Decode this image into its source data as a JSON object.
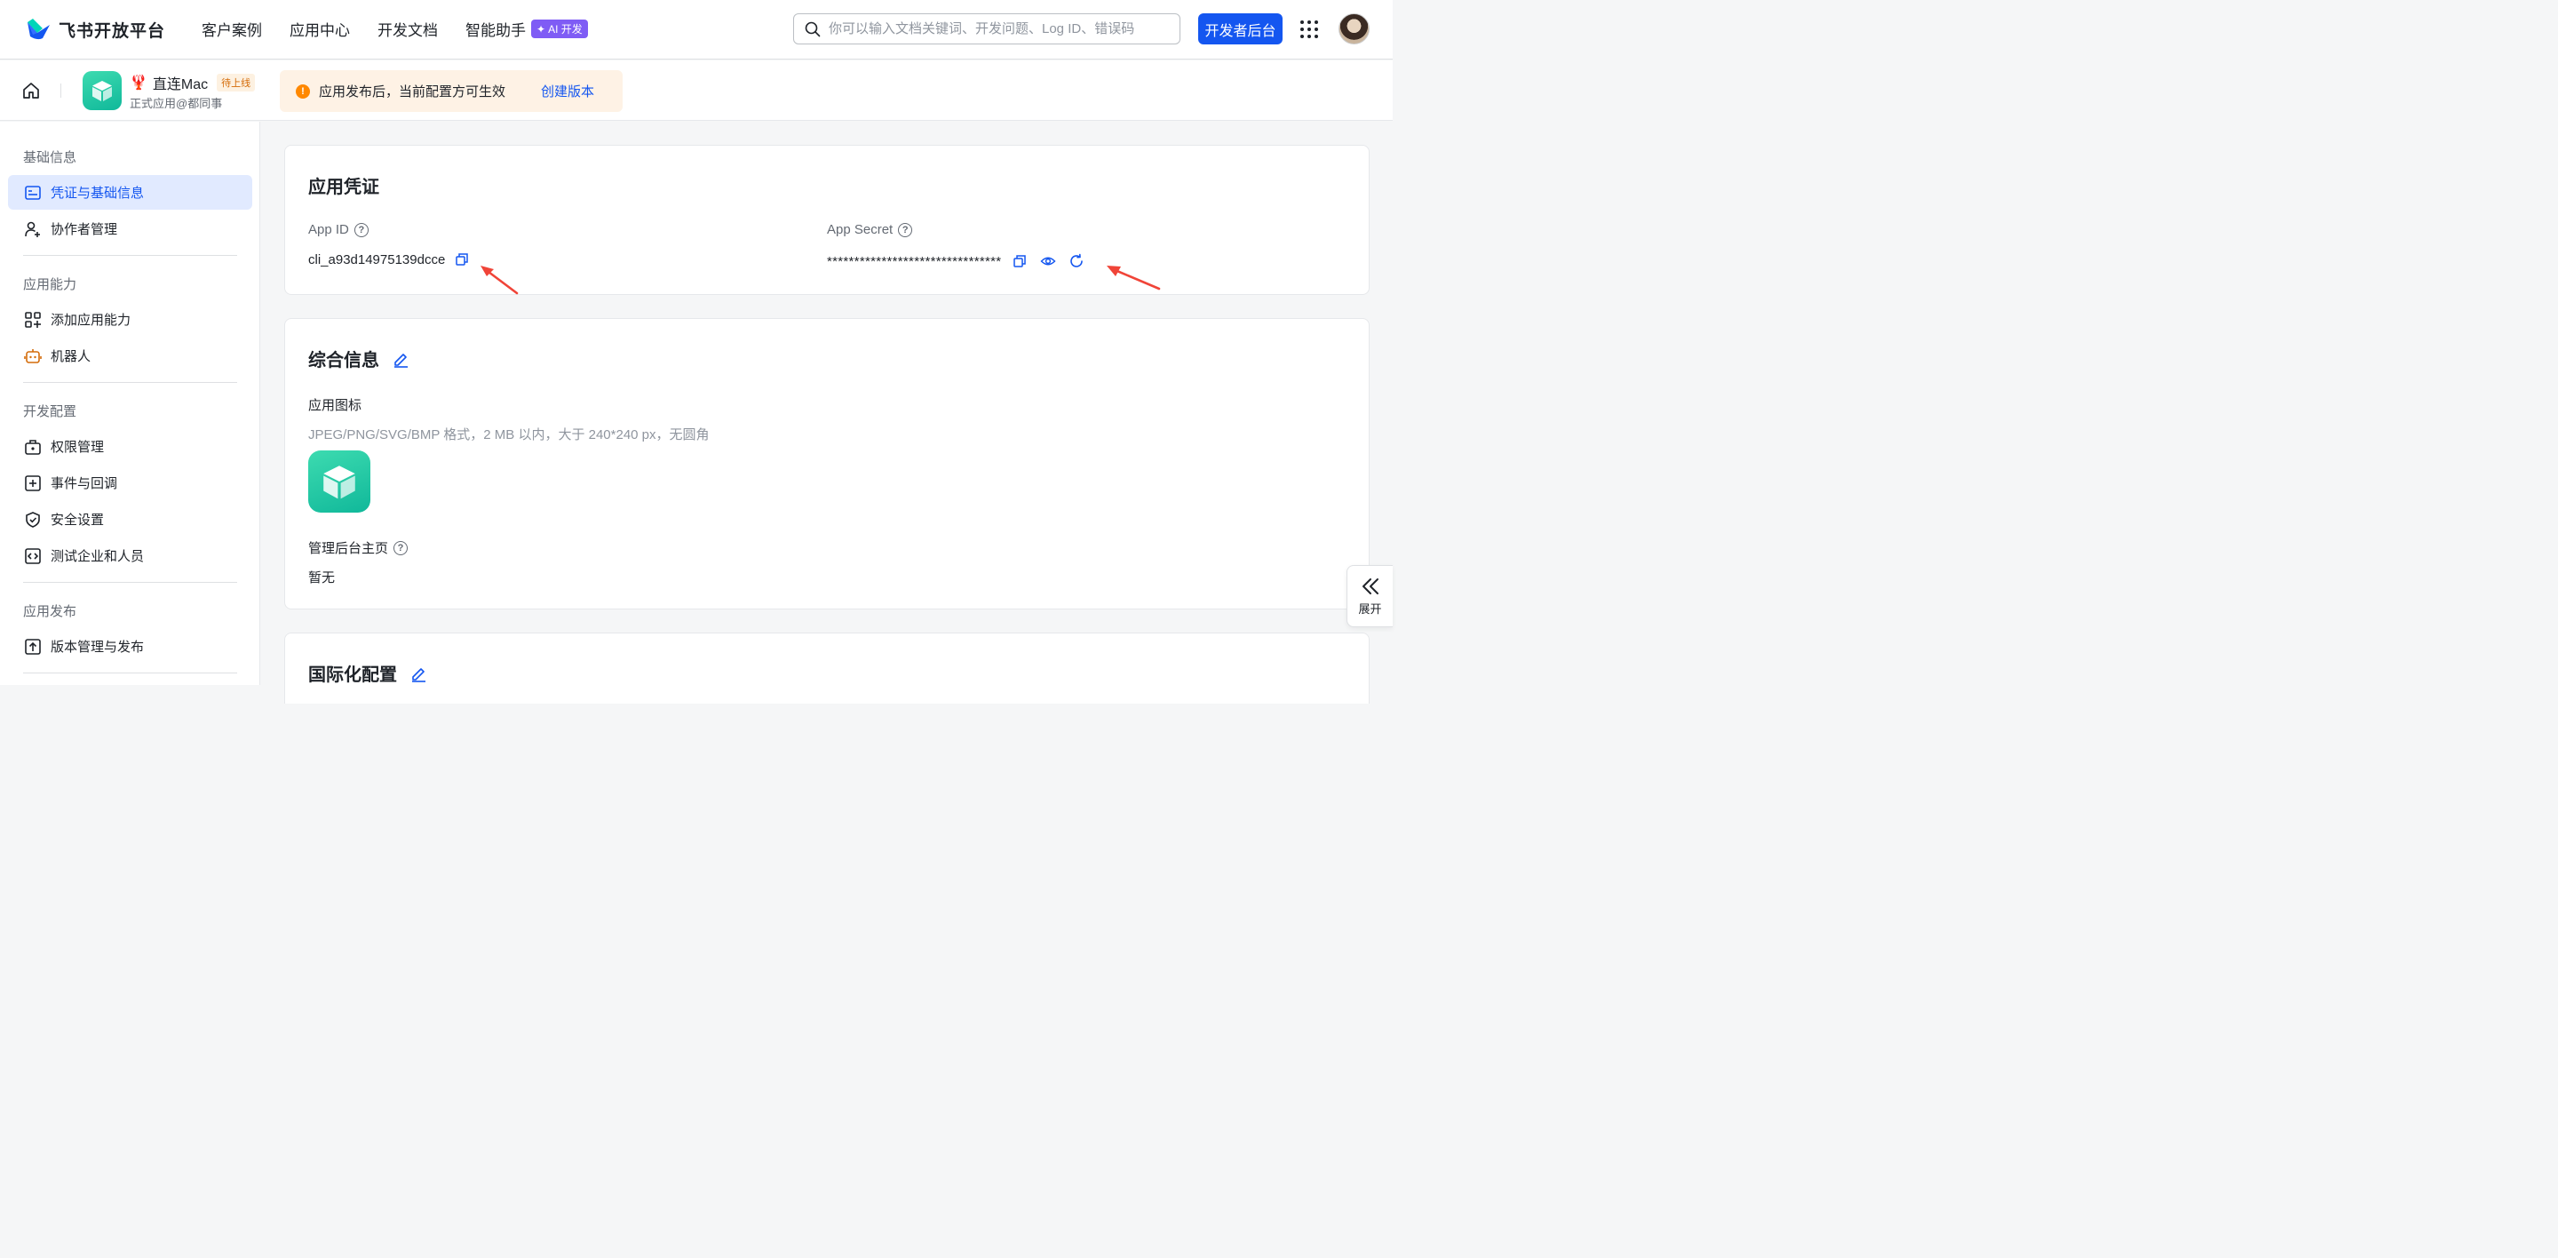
{
  "topbar": {
    "brand": "飞书开放平台",
    "nav": [
      "客户案例",
      "应用中心",
      "开发文档",
      "智能助手"
    ],
    "ai_badge": "AI 开发",
    "search_placeholder": "你可以输入文档关键词、开发问题、Log ID、错误码",
    "dev_console_label": "开发者后台"
  },
  "appbar": {
    "app_name": "直连Mac",
    "status": "待上线",
    "owner": "正式应用@都同事",
    "notice": "应用发布后，当前配置方可生效",
    "notice_link": "创建版本"
  },
  "sidebar": {
    "groups": [
      {
        "title": "基础信息",
        "items": [
          "凭证与基础信息",
          "协作者管理"
        ]
      },
      {
        "title": "应用能力",
        "items": [
          "添加应用能力",
          "机器人"
        ]
      },
      {
        "title": "开发配置",
        "items": [
          "权限管理",
          "事件与回调",
          "安全设置",
          "测试企业和人员"
        ]
      },
      {
        "title": "应用发布",
        "items": [
          "版本管理与发布"
        ]
      }
    ],
    "active_item": "凭证与基础信息"
  },
  "credentials": {
    "title": "应用凭证",
    "app_id_label": "App ID",
    "app_id_value": "cli_a93d14975139dcce",
    "app_secret_label": "App Secret",
    "app_secret_value": "********************************"
  },
  "general": {
    "title": "综合信息",
    "icon_label": "应用图标",
    "icon_hint": "JPEG/PNG/SVG/BMP 格式，2 MB 以内，大于 240*240 px，无圆角",
    "homepage_label": "管理后台主页",
    "homepage_value": "暂无"
  },
  "i18n": {
    "title": "国际化配置"
  },
  "expand_label": "展开",
  "colors": {
    "primary": "#1456f0",
    "annotation_arrow": "#f04438",
    "app_icon": "#14c0a0"
  }
}
